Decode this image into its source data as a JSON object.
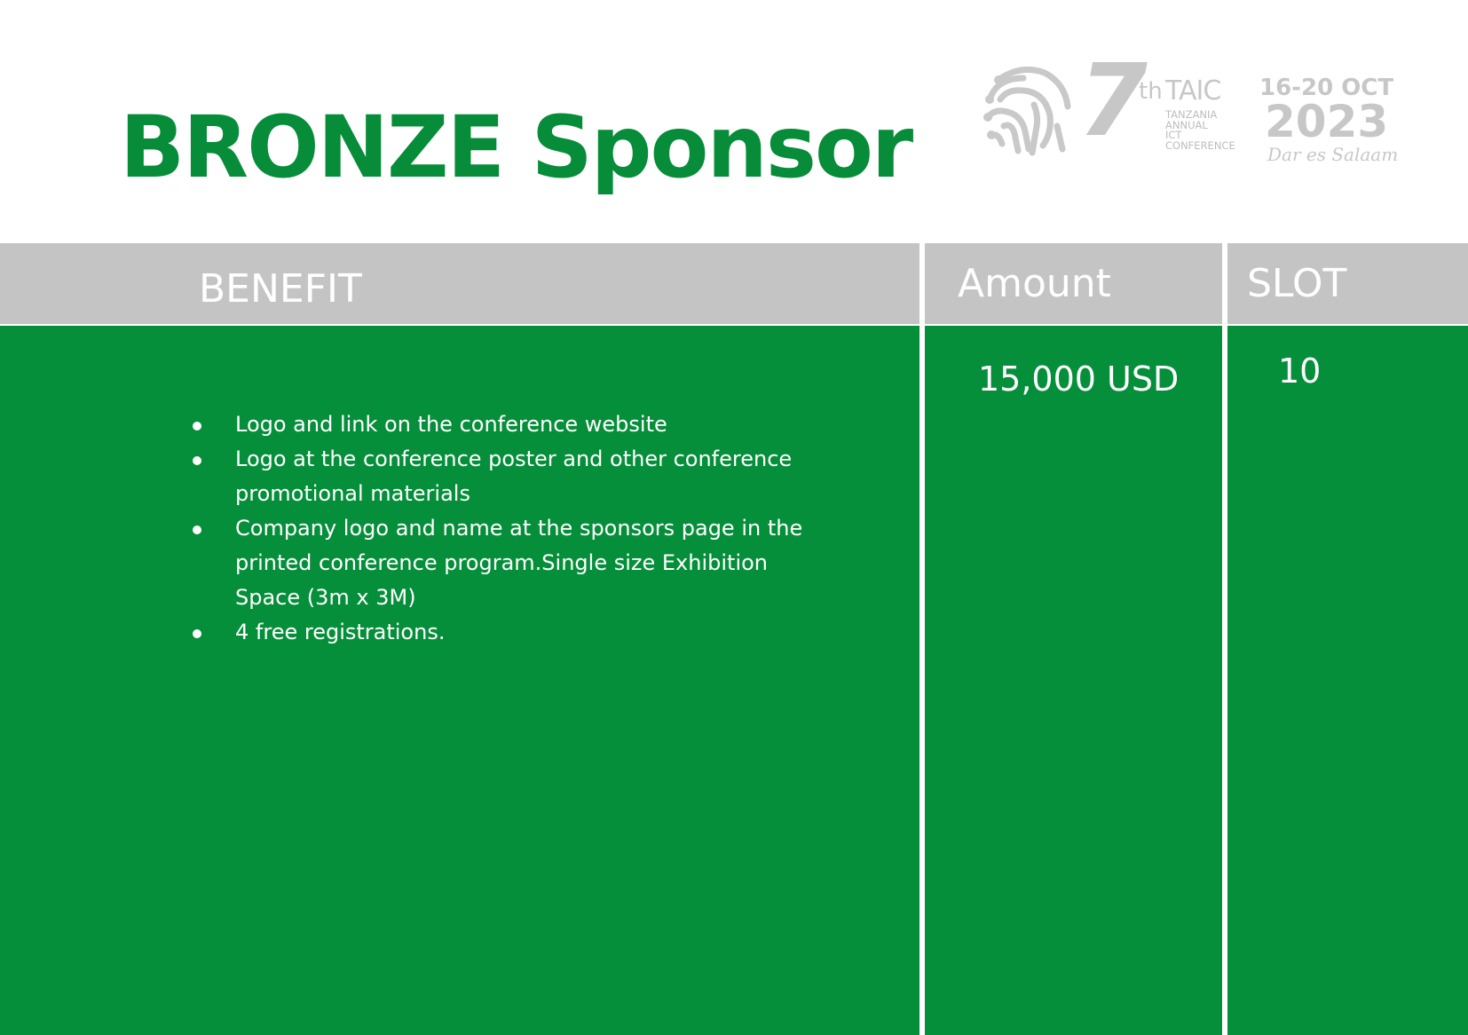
{
  "title": "BRONZE Sponsor",
  "logo": {
    "icon": "fingerprint-circuit-icon",
    "edition_number": "7",
    "edition_suffix": "th",
    "acronym": "TAIC",
    "subtitle_lines": [
      "TANZANIA",
      "ANNUAL",
      "ICT",
      "CONFERENCE"
    ],
    "dates": "16-20 OCT",
    "year": "2023",
    "city": "Dar es Salaam"
  },
  "table": {
    "headers": {
      "benefit": "BENEFIT",
      "amount": "Amount",
      "slot": "SLOT"
    },
    "row": {
      "benefits": [
        "Logo and link on the conference website",
        "Logo at the conference poster and other conference promotional materials",
        "Company logo and name at the sponsors page in the printed conference program.Single size Exhibition Space (3m x 3M)",
        "4 free registrations."
      ],
      "amount": "15,000 USD",
      "slot": "10"
    }
  },
  "colors": {
    "brand_green": "#078c39",
    "cell_green": "#068f3a",
    "header_gray": "#c4c4c4",
    "logo_gray": "#c7c7c7"
  }
}
